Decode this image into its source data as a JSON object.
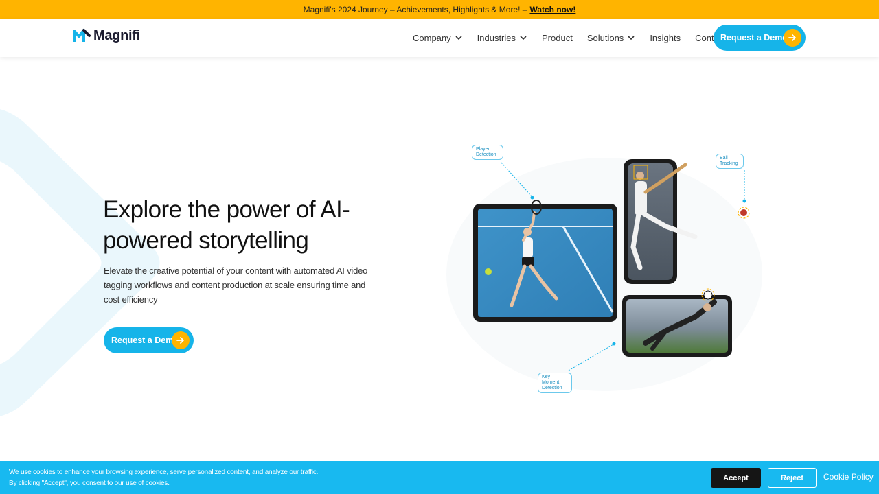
{
  "announcement": {
    "text": "Magnifi's 2024 Journey – Achievements, Highlights & More! –",
    "link": "Watch now!"
  },
  "brand": {
    "name": "Magnifi",
    "accent": "#16b4e9",
    "highlight": "#ffb400"
  },
  "nav": {
    "items": [
      {
        "label": "Company",
        "has_dropdown": true
      },
      {
        "label": "Industries",
        "has_dropdown": true
      },
      {
        "label": "Product",
        "has_dropdown": false
      },
      {
        "label": "Solutions",
        "has_dropdown": true
      },
      {
        "label": "Insights",
        "has_dropdown": false
      },
      {
        "label": "Contact",
        "has_dropdown": false
      }
    ],
    "cta": "Request a Demo"
  },
  "hero": {
    "title": "Explore the power of AI-powered storytelling",
    "subtitle": "Elevate the creative potential of your content with automated AI video tagging workflows and content production at scale ensuring time and cost efficiency",
    "cta": "Request a Demo"
  },
  "illustration": {
    "tags": {
      "player": "Player Detection",
      "ball": "Ball Tracking",
      "moment": "Key Moment Detection"
    }
  },
  "cookie": {
    "line1": "We use cookies to enhance your browsing experience, serve personalized content, and analyze our traffic.",
    "line2": "By clicking \"Accept\", you consent to our use of cookies.",
    "accept": "Accept",
    "reject": "Reject",
    "policy": "Cookie Policy"
  }
}
